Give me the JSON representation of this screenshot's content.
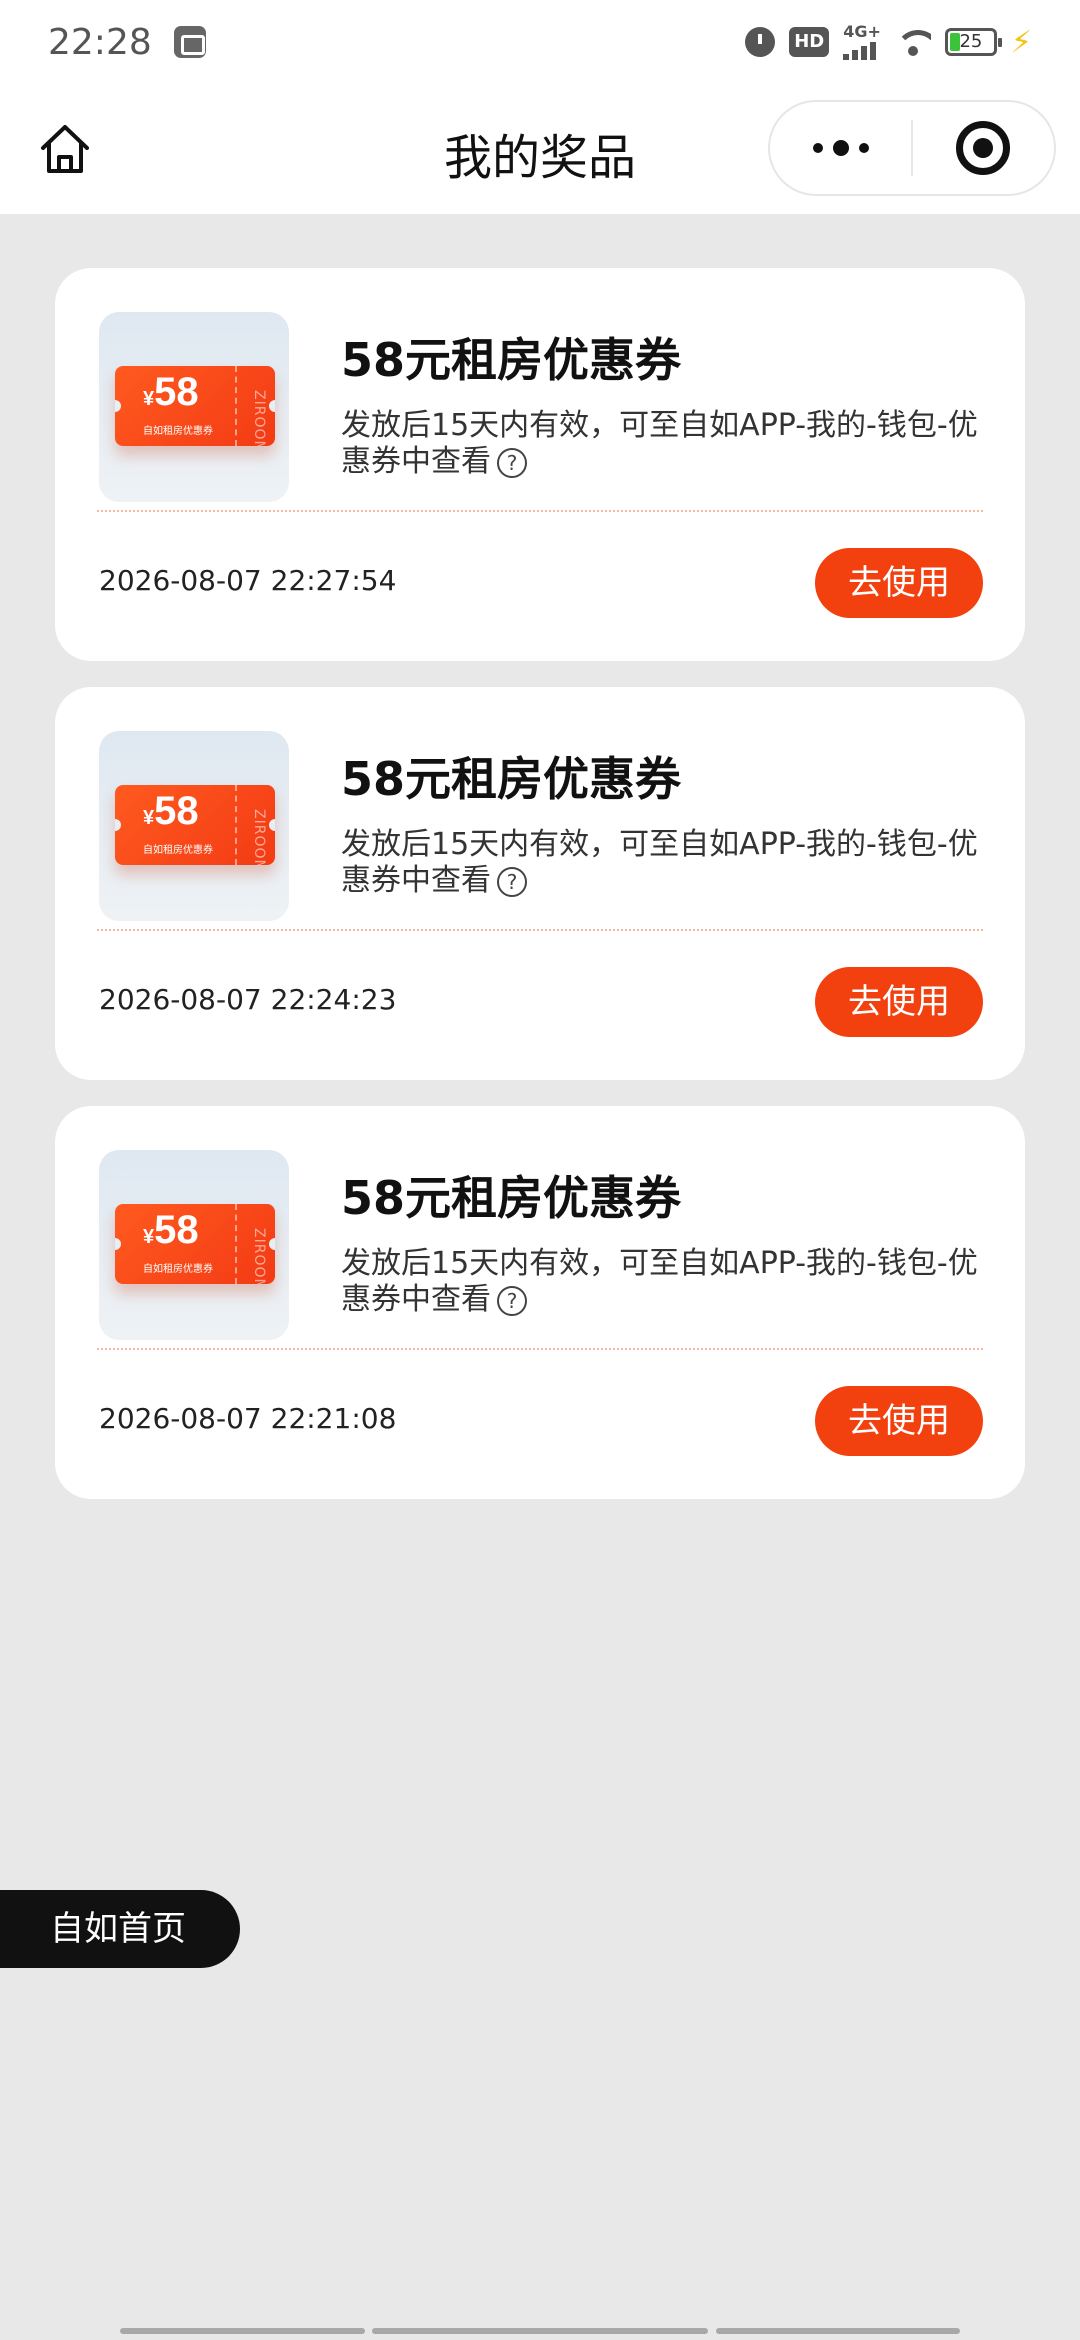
{
  "status_bar": {
    "time": "22:28",
    "network": "4G+",
    "hd": "HD",
    "battery": "25"
  },
  "nav": {
    "title": "我的奖品"
  },
  "coupon_thumb": {
    "currency": "¥",
    "amount": "58",
    "subtitle": "自如租房优惠券",
    "brand": "ZIROOM"
  },
  "prizes": [
    {
      "title": "58元租房优惠券",
      "desc": "发放后15天内有效，可至自如APP-我的-钱包-优惠券中查看",
      "time": "2026-08-07 22:27:54",
      "button": "去使用"
    },
    {
      "title": "58元租房优惠券",
      "desc": "发放后15天内有效，可至自如APP-我的-钱包-优惠券中查看",
      "time": "2026-08-07 22:24:23",
      "button": "去使用"
    },
    {
      "title": "58元租房优惠券",
      "desc": "发放后15天内有效，可至自如APP-我的-钱包-优惠券中查看",
      "time": "2026-08-07 22:21:08",
      "button": "去使用"
    }
  ],
  "home_float_label": "自如首页",
  "colors": {
    "accent": "#f2410f",
    "background": "#e8e8e8"
  }
}
